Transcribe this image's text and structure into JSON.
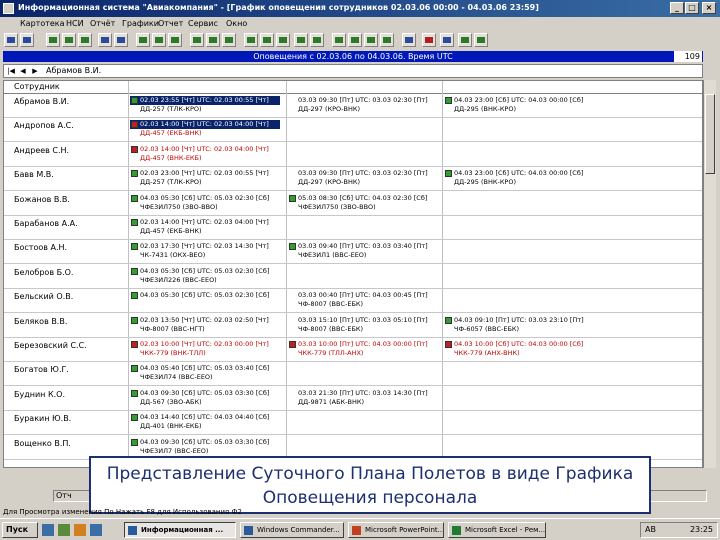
{
  "window": {
    "title": "Информационная система \"Авиакомпания\" - [График оповещения сотрудников 02.03.06 00:00 - 04.03.06 23:59]",
    "controls": [
      "_",
      "□",
      "×"
    ]
  },
  "menu": [
    "Картотека",
    "НСИ",
    "Отчёт",
    "Графики",
    "Отчет",
    "Сервис",
    "Окно"
  ],
  "range_bar": {
    "text": "Оповещения с 02.03.06 по 04.03.06. Время UTC",
    "count": "109"
  },
  "nav": {
    "current": "Абрамов В.И."
  },
  "grid": {
    "header": "Сотрудник",
    "rows": [
      {
        "name": "Абрамов В.И.",
        "cells": [
          {
            "type": "green",
            "sel": true,
            "l1": "02.03 23:55 [Чт] UTC: 02.03 00:55 [Чт]",
            "l2": "ДД-257 (ТЛК-КРО)"
          },
          {
            "type": "blank",
            "l1": "03.03 09:30 [Пт] UTC: 03.03 02:30 [Пт]",
            "l2": "ДД-297 (КРО-ВНК)"
          },
          {
            "type": "green",
            "l1": "04.03 23:00 [Сб] UTC: 04.03 00:00 [Сб]",
            "l2": "ДД-295 (ВНК-КРО)"
          }
        ]
      },
      {
        "name": "Андропов А.С.",
        "cells": [
          {
            "type": "red",
            "sel": true,
            "l1": "02.03 14:00 [Чт] UTC: 02.03 04:00 [Чт]",
            "l2": "ДД-457 (ЕКБ-ВНК)"
          }
        ]
      },
      {
        "name": "Андреев С.Н.",
        "cells": [
          {
            "type": "red",
            "l1": "02.03 14:00 [Чт] UTC: 02.03 04:00 [Чт]",
            "l2": "ДД-457 (ВНК-ЕКБ)"
          }
        ]
      },
      {
        "name": "Бавв М.В.",
        "cells": [
          {
            "type": "green",
            "l1": "02.03 23:00 [Чт] UTC: 02.03 00:55 [Чт]",
            "l2": "ДД-257 (ТЛК-КРО)"
          },
          {
            "type": "blank",
            "l1": "03.03 09:30 [Пт] UTC: 03.03 02:30 [Пт]",
            "l2": "ДД-297 (КРО-ВНК)"
          },
          {
            "type": "green",
            "l1": "04.03 23:00 [Сб] UTC: 04.03 00:00 [Сб]",
            "l2": "ДД-295 (ВНК-КРО)"
          }
        ]
      },
      {
        "name": "Божанов В.В.",
        "cells": [
          {
            "type": "green",
            "l1": "04.03 05:30 [Сб] UTC: 05.03 02:30 [Сб]",
            "l2": "ЧФЕ3ИЛ750 (ЗВО-ВВО)"
          },
          {
            "type": "green",
            "l1": "05.03 08:30 [Сб] UTC: 04.03 02:30 [Сб]",
            "l2": "ЧФЕ3ИЛ750 (ЗВО-ВВО)"
          }
        ]
      },
      {
        "name": "Барабанов А.А.",
        "cells": [
          {
            "type": "green",
            "l1": "02.03 14:00 [Чт] UTC: 02.03 04:00 [Чт]",
            "l2": "ДД-457 (ЕКБ-ВНК)"
          }
        ]
      },
      {
        "name": "Бостоов А.Н.",
        "cells": [
          {
            "type": "green",
            "l1": "02.03 17:30 [Чт] UTC: 02.03 14:30 [Чт]",
            "l2": "ЧК-7431 (ОКХ-ВЕО)"
          },
          {
            "type": "green",
            "l1": "03.03 09:40 [Пт] UTC: 03.03 03:40 [Пт]",
            "l2": "ЧФЕ3ИЛ1 (ВВС-ЕЕО)"
          }
        ]
      },
      {
        "name": "Белобров Б.О.",
        "cells": [
          {
            "type": "green",
            "l1": "04.03 05:30 [Сб] UTC: 05.03 02:30 [Сб]",
            "l2": "ЧФЕ3ИЛ226 (ВВС-ЕЕО)"
          }
        ]
      },
      {
        "name": "Бельский О.В.",
        "cells": [
          {
            "type": "green",
            "l1": "04.03 05:30 [Сб] UTC: 05.03 02:30 [Сб]",
            "l2": ""
          },
          {
            "type": "blank",
            "l1": "03.03 00:40 [Пт] UTC: 04.03 00:45 [Пт]",
            "l2": "ЧФ-8007 (ВВС-ЕБК)"
          }
        ]
      },
      {
        "name": "Беляков В.В.",
        "cells": [
          {
            "type": "green",
            "l1": "02.03 13:50 [Чт] UTC: 02.03 02:50 [Чт]",
            "l2": "ЧФ-8007 (ВВС-НГТ)"
          },
          {
            "type": "blank",
            "l1": "03.03 15:10 [Пт] UTC: 03.03 05:10 [Пт]",
            "l2": "ЧФ-8007 (ВВС-ЕБК)"
          },
          {
            "type": "green",
            "l1": "04.03 09:10 [Пт] UTC: 03.03 23:10 [Пт]",
            "l2": "ЧФ-6057 (ВВС-ЕБК)"
          }
        ]
      },
      {
        "name": "Березовский С.С.",
        "cells": [
          {
            "type": "red",
            "l1": "02.03 10:00 [Чт] UTC: 02.03 00:00 [Чт]",
            "l2": "ЧКК-779 (ВНК-ТЛЛ)"
          },
          {
            "type": "red",
            "l1": "03.03 10:00 [Пт] UTC: 04.03 00:00 [Пт]",
            "l2": "ЧКК-779 (ТЛЛ-АНХ)"
          },
          {
            "type": "red",
            "l1": "04.03 10:00 [Сб] UTC: 04.03 00:00 [Сб]",
            "l2": "ЧКК-779 (АНХ-ВНК)"
          }
        ]
      },
      {
        "name": "Богатов Ю.Г.",
        "cells": [
          {
            "type": "green",
            "l1": "04.03 05:40 [Сб] UTC: 05.03 03:40 [Сб]",
            "l2": "ЧФЕ3ИЛ74 (ВВС-ЕЕО)"
          }
        ]
      },
      {
        "name": "Буднин К.О.",
        "cells": [
          {
            "type": "green",
            "l1": "04.03 09:30 [Сб] UTC: 05.03 03:30 [Сб]",
            "l2": "ДД-567 (ЗВО-АБК)"
          },
          {
            "type": "blank",
            "l1": "03.03 21:30 [Пт] UTC: 03.03 14:30 [Пт]",
            "l2": "ДД-9871 (АБК-ВНК)"
          }
        ]
      },
      {
        "name": "Буракин Ю.В.",
        "cells": [
          {
            "type": "green",
            "l1": "04.03 14:40 [Сб] UTC: 04.03 04:40 [Сб]",
            "l2": "ДД-401 (ВНК-ЕКБ)"
          }
        ]
      },
      {
        "name": "Вощенко В.П.",
        "cells": [
          {
            "type": "green",
            "l1": "04.03 09:30 [Сб] UTC: 05.03 03:30 [Сб]",
            "l2": "ЧФЕ3ИЛ7 (ВВС-ЕЕО)"
          }
        ]
      }
    ]
  },
  "overlay": {
    "line1": "Представление Суточного Плана Полетов в виде Графика",
    "line2": "Оповещения персонала"
  },
  "status_left": "Отч",
  "hint": "Для Просмотра изменения По Нажать F8 для Использования Ф2",
  "taskbar": {
    "start": "Пуск",
    "tasks": [
      "Информационная ...",
      "Windows Commander...",
      "Microsoft PowerPoint...",
      "Microsoft Excel - Рем..."
    ],
    "lang": "AB",
    "clock": "23:25"
  }
}
